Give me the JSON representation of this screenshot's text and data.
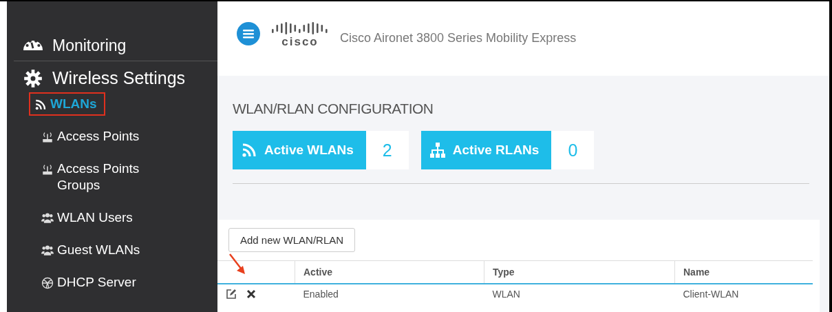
{
  "sidebar": {
    "sections": [
      {
        "label": "Monitoring",
        "kind": "gauge"
      },
      {
        "label": "Wireless Settings",
        "kind": "gear",
        "children": [
          {
            "label": "WLANs",
            "kind": "wifi",
            "selected": true,
            "annotated": true
          },
          {
            "label": "Access Points",
            "kind": "ap",
            "selected": false,
            "annotated": false
          },
          {
            "label": "Access Points Groups",
            "kind": "ap",
            "selected": false,
            "annotated": false
          },
          {
            "label": "WLAN Users",
            "kind": "users",
            "selected": false,
            "annotated": false
          },
          {
            "label": "Guest WLANs",
            "kind": "users",
            "selected": false,
            "annotated": false
          },
          {
            "label": "DHCP Server",
            "kind": "ball",
            "selected": false,
            "annotated": false
          }
        ]
      }
    ]
  },
  "header": {
    "logo": "cisco",
    "title": "Cisco Aironet 3800 Series Mobility Express"
  },
  "page": {
    "heading": "WLAN/RLAN CONFIGURATION",
    "tiles": [
      {
        "label": "Active WLANs",
        "kind": "wifi",
        "count": "2"
      },
      {
        "label": "Active RLANs",
        "kind": "network",
        "count": "0"
      }
    ],
    "add_button": "Add new WLAN/RLAN",
    "table": {
      "columns": [
        "Active",
        "Type",
        "Name"
      ],
      "rows": [
        {
          "cells": [
            "Enabled",
            "WLAN",
            "Client-WLAN"
          ],
          "annotated": true
        }
      ]
    }
  }
}
